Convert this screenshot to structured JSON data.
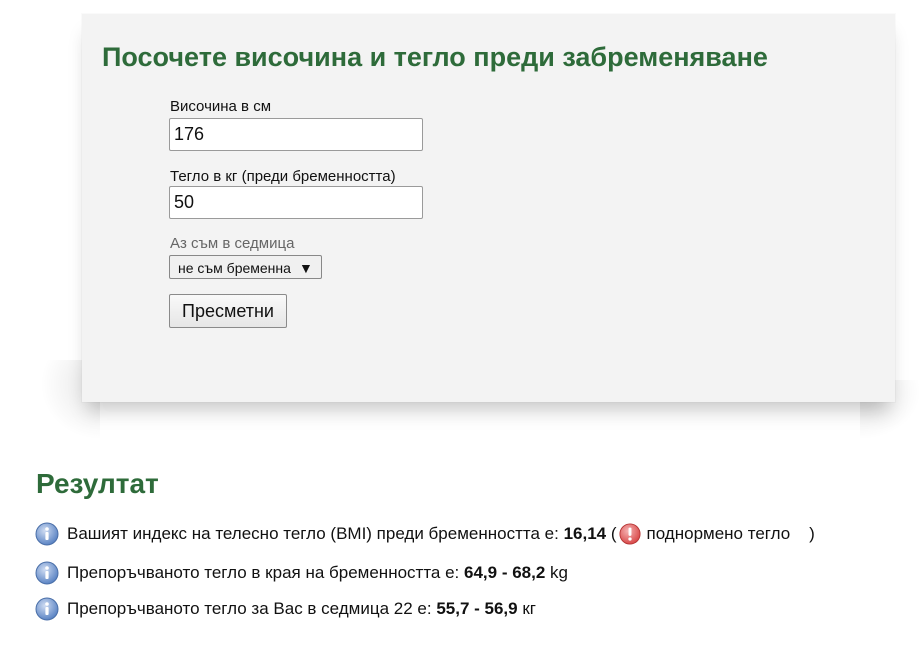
{
  "form": {
    "title": "Посочете височина и тегло преди забременяване",
    "height_label": "Височина в см",
    "height_value": "176",
    "weight_label": "Тегло в кг (преди бременността)",
    "weight_value": "50",
    "week_label": "Аз съм в седмица",
    "week_selected": "не съм бременна",
    "calc_button": "Пресметни"
  },
  "result": {
    "heading": "Резултат",
    "bmi": {
      "icon": "info-icon",
      "text": "Вашият индекс на телесно тегло (BMI) преди бременността е:",
      "value": "16,14",
      "open_paren": "(",
      "status_icon": "warning-icon",
      "status_text": "поднормено тегло",
      "close_paren": ")"
    },
    "end_weight": {
      "icon": "info-icon",
      "text": "Препоръчваното тегло в края на бременността е:",
      "range": "64,9 - 68,2",
      "unit": "kg"
    },
    "week_weight": {
      "icon": "info-icon",
      "text": "Препоръчваното тегло за Вас в седмица 22 е:",
      "range": "55,7 - 56,9",
      "unit": "кг"
    }
  },
  "colors": {
    "heading_green": "#2e6b3a",
    "card_bg": "#f3f3f3",
    "info_blue": "#5b84c4",
    "warning_red": "#d94a4a"
  }
}
